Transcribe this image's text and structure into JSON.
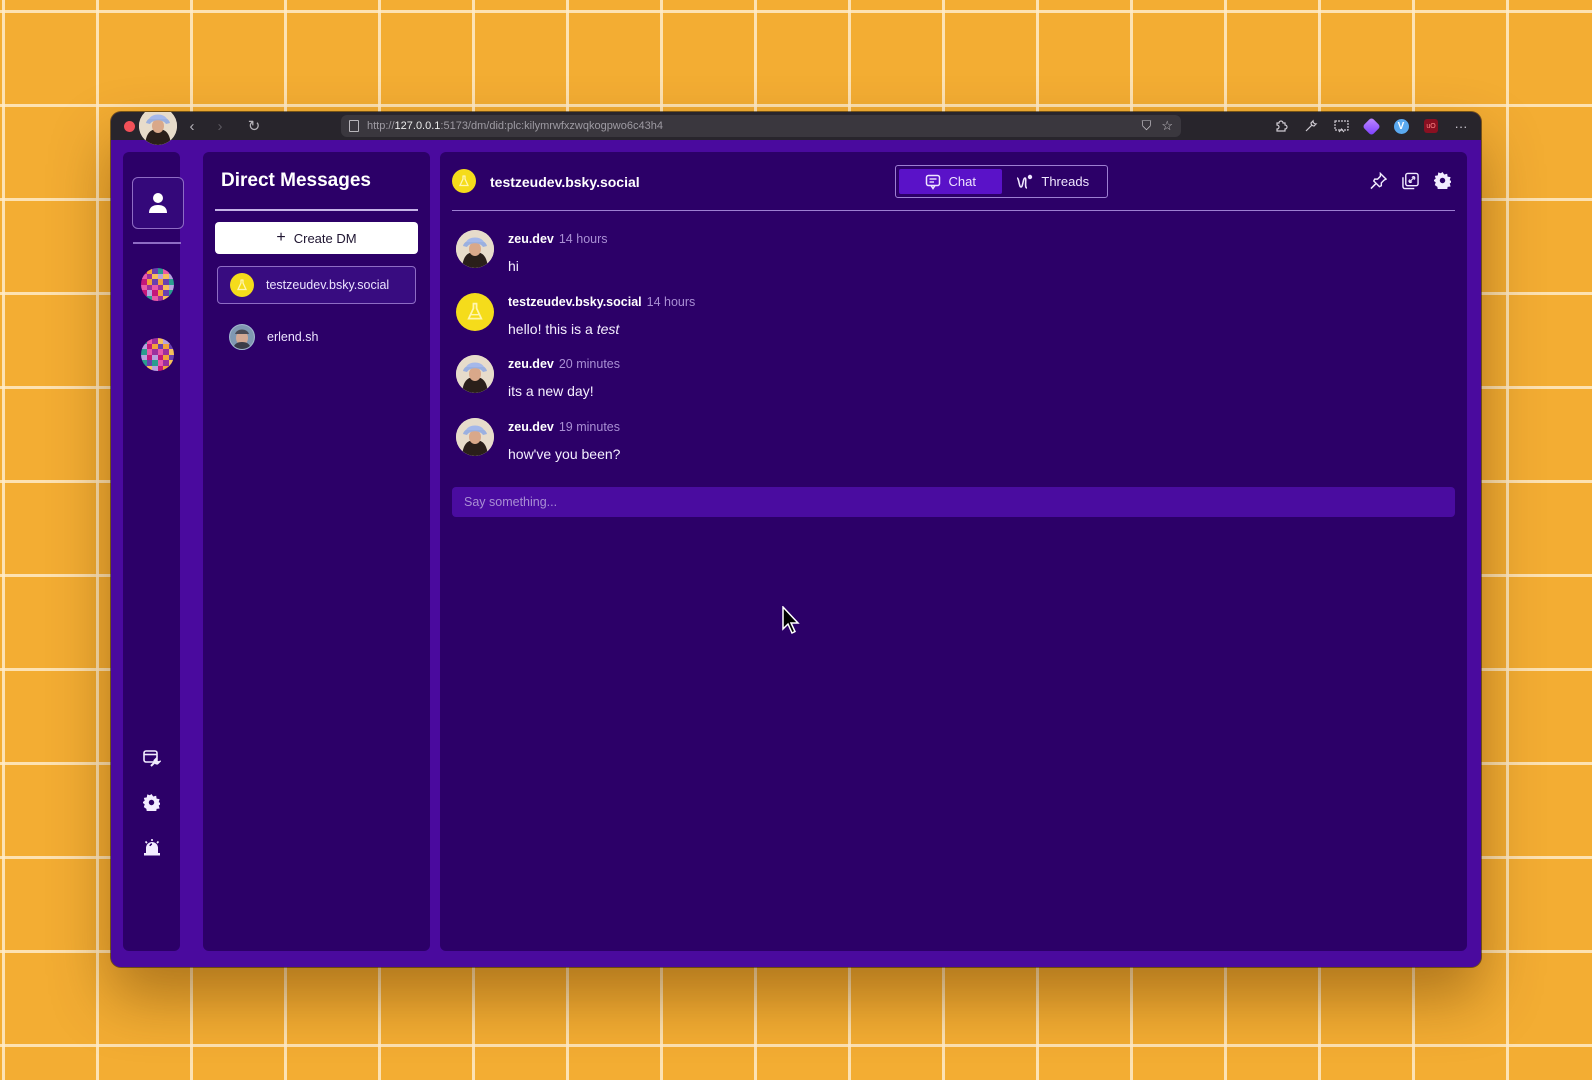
{
  "browser": {
    "url_scheme": "http://",
    "url_host": "127.0.0.1",
    "url_rest": ":5173/dm/did:plc:kilymrwfxzwqkogpwo6c43h4",
    "nav_back_icon": "‹",
    "nav_forward_icon": "›",
    "reload_icon": "↻",
    "shield_icon": "⛉",
    "star_icon": "☆",
    "extensions": [
      "puzzle-icon",
      "wrench-icon",
      "screen-icon",
      "diamond-extension",
      "v-extension",
      "ublock-extension",
      "more-icon"
    ],
    "more_label": "···",
    "ext_v_label": "V",
    "ext_ub_label": "uO"
  },
  "rail": {
    "home_icon": "user-icon",
    "spaces": [
      "pixel-avatar-1",
      "pixel-avatar-2"
    ],
    "bottom_icons": [
      "dev-tools-icon",
      "settings-icon",
      "alarm-icon"
    ]
  },
  "dm_panel": {
    "title": "Direct Messages",
    "create_label": "Create DM",
    "create_icon": "+",
    "items": [
      {
        "name": "testzeudev.bsky.social",
        "avatar": "yellow-flask",
        "active": true
      },
      {
        "name": "erlend.sh",
        "avatar": "photo",
        "active": false
      }
    ]
  },
  "chat": {
    "header_name": "testzeudev.bsky.social",
    "tabs": [
      {
        "label": "Chat",
        "icon": "chat-icon",
        "active": true
      },
      {
        "label": "Threads",
        "icon": "threads-icon",
        "active": false
      }
    ],
    "actions": [
      "pin-icon",
      "link-icon",
      "settings-icon"
    ],
    "messages": [
      {
        "author": "zeu.dev",
        "time": "14 hours",
        "body": "hi",
        "avatar": "photo"
      },
      {
        "author": "testzeudev.bsky.social",
        "time": "14 hours",
        "body_prefix": "hello! this is a ",
        "body_em": "test",
        "avatar": "yellow-flask"
      },
      {
        "author": "zeu.dev",
        "time": "20 minutes",
        "body": "its a new day!",
        "avatar": "photo"
      },
      {
        "author": "zeu.dev",
        "time": "19 minutes",
        "body": "how've you been?",
        "avatar": "photo"
      }
    ],
    "composer_placeholder": "Say something...",
    "composer_value": ""
  },
  "colors": {
    "background": "#f3ad33",
    "app_frame": "#4a0a9e",
    "panel": "#2c0068",
    "accent": "#5a12c8",
    "muted_text": "#a98fd4",
    "yellow_avatar": "#f5dc1b"
  }
}
